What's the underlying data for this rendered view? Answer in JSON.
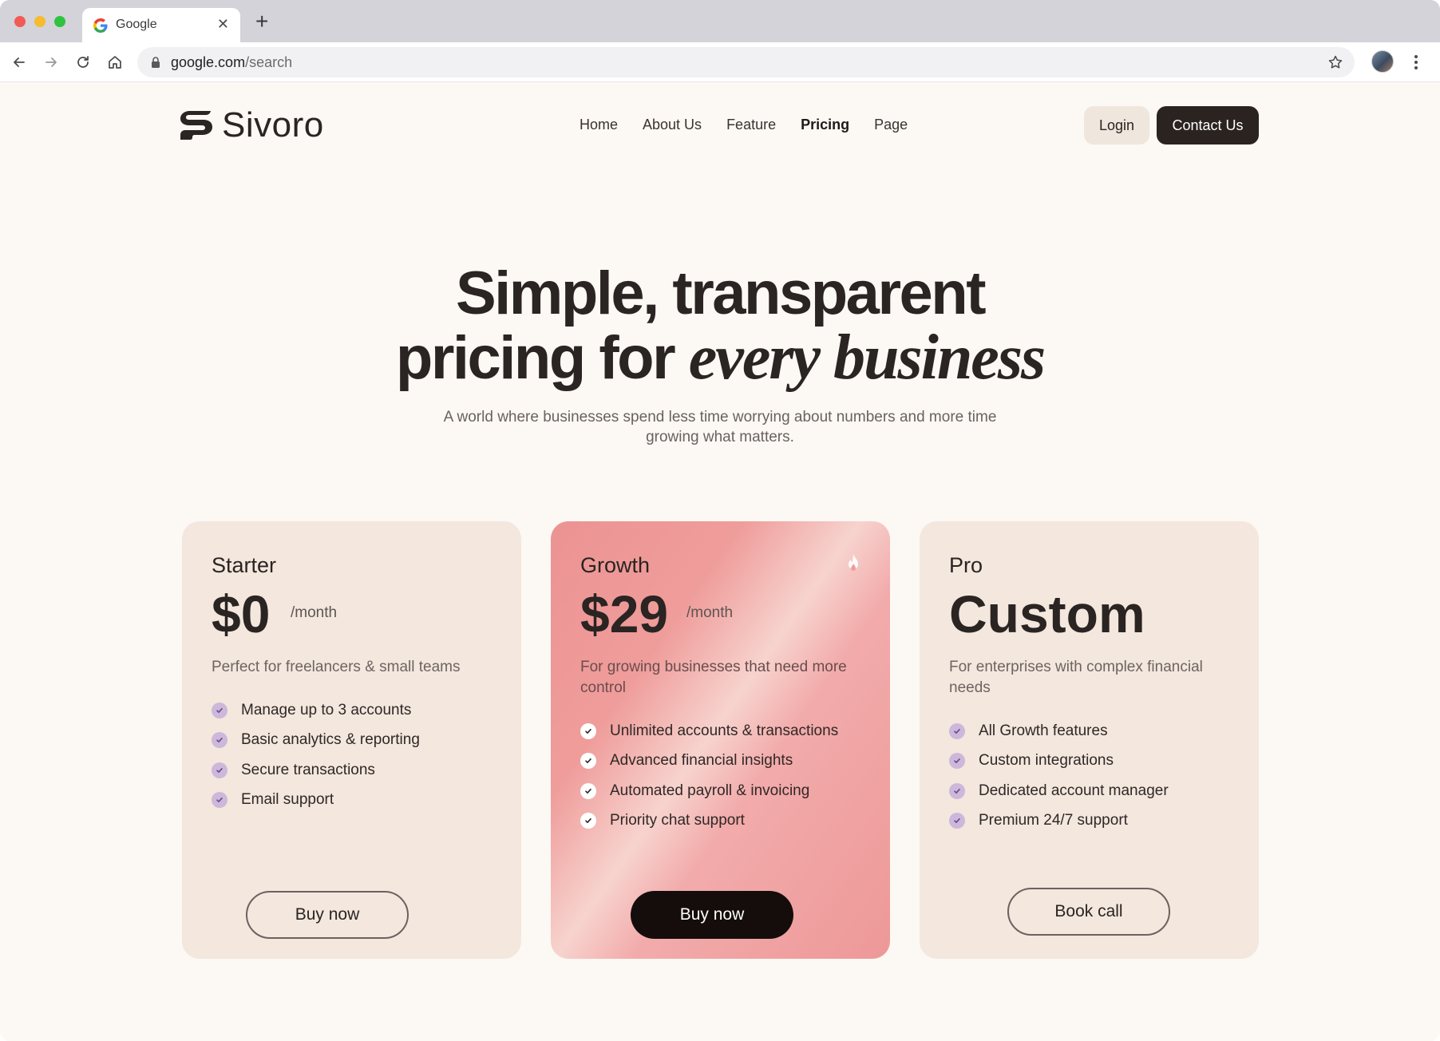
{
  "browser": {
    "tab_title": "Google",
    "url_domain": "google.com",
    "url_path": "/search"
  },
  "brand": {
    "name": "Sivoro"
  },
  "nav": {
    "items": [
      {
        "label": "Home",
        "active": false
      },
      {
        "label": "About Us",
        "active": false
      },
      {
        "label": "Feature",
        "active": false
      },
      {
        "label": "Pricing",
        "active": true
      },
      {
        "label": "Page",
        "active": false
      }
    ],
    "login_label": "Login",
    "contact_label": "Contact Us"
  },
  "hero": {
    "title_line1": "Simple, transparent",
    "title_line2_plain": "pricing for ",
    "title_line2_italic": "every business",
    "subtitle": "A world where businesses spend less time worrying about numbers and more time growing what matters."
  },
  "plans": [
    {
      "name": "Starter",
      "price": "$0",
      "period": "/month",
      "description": "Perfect for freelancers & small teams",
      "features": [
        "Manage up to 3 accounts",
        "Basic analytics & reporting",
        "Secure transactions",
        "Email support"
      ],
      "button": "Buy now"
    },
    {
      "name": "Growth",
      "price": "$29",
      "period": "/month",
      "description": "For growing businesses that need more control",
      "features": [
        "Unlimited accounts & transactions",
        "Advanced financial insights",
        "Automated payroll & invoicing",
        "Priority chat support"
      ],
      "button": "Buy now",
      "icon": "flame-icon"
    },
    {
      "name": "Pro",
      "price": "Custom",
      "period": "",
      "description": "For enterprises with complex financial needs",
      "features": [
        "All Growth features",
        "Custom integrations",
        "Dedicated account manager",
        "Premium 24/7 support"
      ],
      "button": "Book call"
    }
  ],
  "colors": {
    "page_bg": "#fcf8f4",
    "card_bg": "#f3e7de",
    "growth_accent": "#ee9898",
    "check_purple": "#cdb7db",
    "dark": "#2a2320"
  }
}
